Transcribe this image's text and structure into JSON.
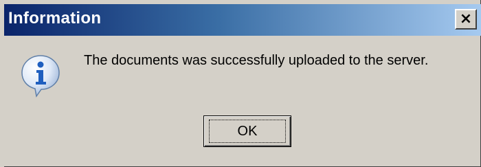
{
  "window": {
    "title": "Information",
    "close_glyph": "×",
    "close_icon": "close-icon",
    "icon": "info-icon"
  },
  "message": "The documents was successfully uploaded to the server.",
  "buttons": {
    "ok_label": "OK"
  },
  "colors": {
    "titlebar_start": "#0a246a",
    "titlebar_end": "#a6caf0",
    "face": "#d4d0c8",
    "icon_blue": "#1f5fbf"
  }
}
